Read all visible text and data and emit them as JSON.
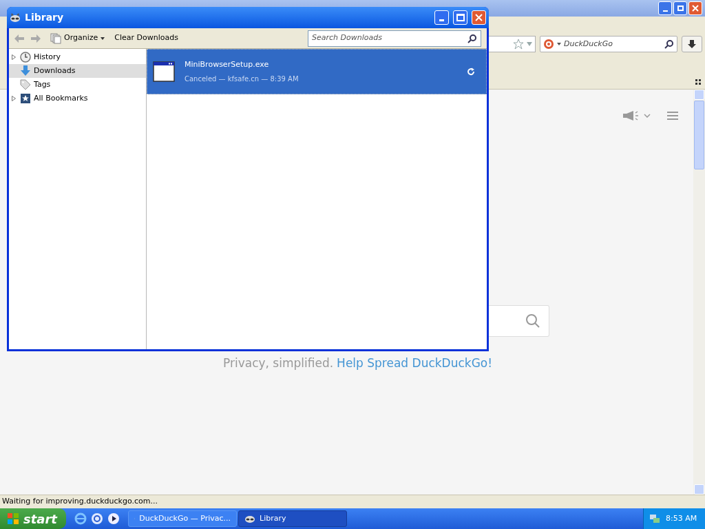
{
  "browser": {
    "search_placeholder": "DuckDuckGo",
    "page": {
      "tagline": "Privacy, simplified.",
      "link": "Help Spread DuckDuckGo!"
    },
    "status_text": "Waiting for improving.duckduckgo.com..."
  },
  "library": {
    "title": "Library",
    "toolbar": {
      "organize": "Organize",
      "clear": "Clear Downloads",
      "search_placeholder": "Search Downloads"
    },
    "sidebar": [
      {
        "label": "History",
        "kind": "clock",
        "expandable": true,
        "selected": false
      },
      {
        "label": "Downloads",
        "kind": "download",
        "expandable": false,
        "selected": true
      },
      {
        "label": "Tags",
        "kind": "tag",
        "expandable": false,
        "selected": false
      },
      {
        "label": "All Bookmarks",
        "kind": "star",
        "expandable": true,
        "selected": false
      }
    ],
    "downloads": [
      {
        "name": "MiniBrowserSetup.exe",
        "status": "Canceled — kfsafe.cn — 8:39 AM",
        "selected": true
      }
    ]
  },
  "taskbar": {
    "start": "start",
    "buttons": [
      {
        "label": "DuckDuckGo — Privac...",
        "selected": false
      },
      {
        "label": "Library",
        "selected": true
      }
    ],
    "clock": "8:53 AM"
  }
}
